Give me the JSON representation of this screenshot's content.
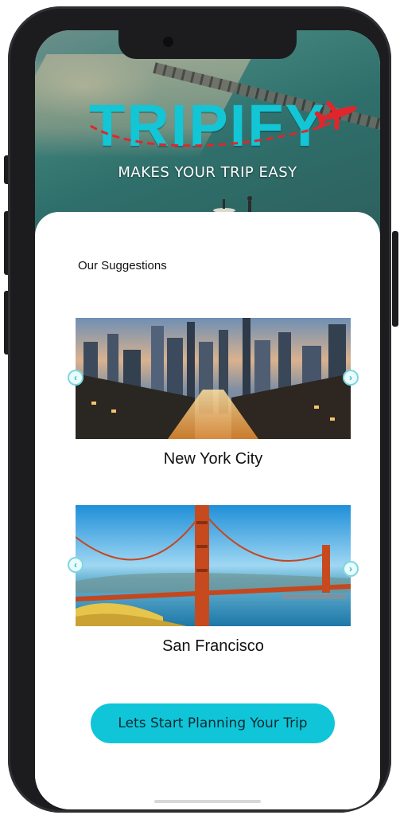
{
  "brand": {
    "logo_text": "TRIPIFY",
    "tagline": "MAKES YOUR TRIP EASY",
    "accent_color": "#12c6d6",
    "plane_color": "#e0262c"
  },
  "suggestions": {
    "heading": "Our Suggestions",
    "cards": [
      {
        "city": "New York City",
        "image": "new-york-skyline-photo"
      },
      {
        "city": "San Francisco",
        "image": "golden-gate-bridge-photo"
      }
    ],
    "prev_icon": "chevron-left-icon",
    "next_icon": "chevron-right-icon"
  },
  "cta": {
    "label": "Lets Start Planning Your Trip",
    "color": "#10c5d8"
  }
}
